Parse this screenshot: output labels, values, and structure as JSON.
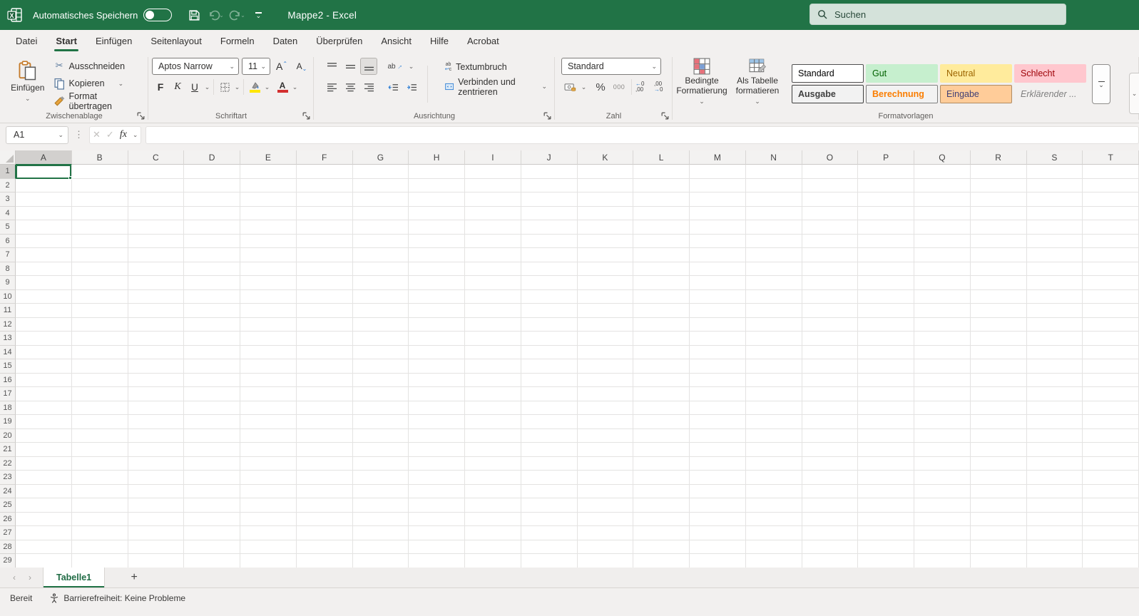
{
  "title_bar": {
    "autosave_label": "Automatisches Speichern",
    "autosave_state": "off",
    "window_title": "Mappe2  -  Excel",
    "search_placeholder": "Suchen"
  },
  "menu": {
    "tabs": [
      {
        "label": "Datei"
      },
      {
        "label": "Start",
        "active": true
      },
      {
        "label": "Einfügen"
      },
      {
        "label": "Seitenlayout"
      },
      {
        "label": "Formeln"
      },
      {
        "label": "Daten"
      },
      {
        "label": "Überprüfen"
      },
      {
        "label": "Ansicht"
      },
      {
        "label": "Hilfe"
      },
      {
        "label": "Acrobat"
      }
    ]
  },
  "ribbon": {
    "clipboard": {
      "group_label": "Zwischenablage",
      "paste_label": "Einfügen",
      "cut_label": "Ausschneiden",
      "copy_label": "Kopieren",
      "format_painter_label": "Format übertragen"
    },
    "font": {
      "group_label": "Schriftart",
      "font_name": "Aptos Narrow",
      "font_size": "11",
      "bold_label": "F",
      "italic_label": "K",
      "underline_label": "U"
    },
    "alignment": {
      "group_label": "Ausrichtung",
      "wrap_label": "Textumbruch",
      "merge_label": "Verbinden und zentrieren"
    },
    "number": {
      "group_label": "Zahl",
      "format_value": "Standard",
      "percent_label": "%",
      "thousand_label": "000"
    },
    "styles": {
      "group_label": "Formatvorlagen",
      "conditional_label": "Bedingte Formatierung",
      "table_label": "Als Tabelle formatieren",
      "cells": [
        {
          "label": "Standard",
          "bg": "#FFFFFF",
          "color": "#000000",
          "border": "#505050",
          "bold": false,
          "italic": false
        },
        {
          "label": "Gut",
          "bg": "#C6EFCE",
          "color": "#006100",
          "border": "",
          "bold": false,
          "italic": false
        },
        {
          "label": "Neutral",
          "bg": "#FFEB9C",
          "color": "#9C6500",
          "border": "",
          "bold": false,
          "italic": false
        },
        {
          "label": "Schlecht",
          "bg": "#FFC7CE",
          "color": "#9C0006",
          "border": "",
          "bold": false,
          "italic": false
        },
        {
          "label": "Ausgabe",
          "bg": "#F2F2F2",
          "color": "#3F3F3F",
          "border": "#3F3F3F",
          "bold": true,
          "italic": false
        },
        {
          "label": "Berechnung",
          "bg": "#F2F2F2",
          "color": "#FA7D00",
          "border": "#7F7F7F",
          "bold": true,
          "italic": false
        },
        {
          "label": "Eingabe",
          "bg": "#FFCC99",
          "color": "#3F3F76",
          "border": "#B08C63",
          "bold": false,
          "italic": false
        },
        {
          "label": "Erklärender ...",
          "bg": "",
          "color": "#7F7F7F",
          "border": "",
          "bold": false,
          "italic": true
        }
      ]
    }
  },
  "formula_bar": {
    "name_box_value": "A1",
    "fx_label": "fx"
  },
  "grid": {
    "columns": [
      "A",
      "B",
      "C",
      "D",
      "E",
      "F",
      "G",
      "H",
      "I",
      "J",
      "K",
      "L",
      "M",
      "N",
      "O",
      "P",
      "Q",
      "R",
      "S",
      "T"
    ],
    "row_count": 29,
    "selected_cell": "A1",
    "selected_col_index": 0,
    "selected_row_index": 0
  },
  "sheet_bar": {
    "tabs": [
      {
        "label": "Tabelle1",
        "active": true
      }
    ],
    "add_label": "+"
  },
  "status_bar": {
    "mode_label": "Bereit",
    "accessibility_label": "Barrierefreiheit: Keine Probleme"
  },
  "colors": {
    "accent_green": "#217346",
    "titlebar": "#217346",
    "search_bg": "#D4E2DA"
  }
}
